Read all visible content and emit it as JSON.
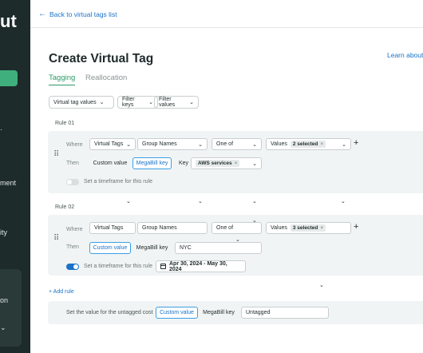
{
  "sidebar": {
    "logo": "ut",
    "items": [
      {
        "label": "ment"
      },
      {
        "label": "ity"
      },
      {
        "label": "on"
      }
    ]
  },
  "topbar": {
    "back_label": "Back to virtual tags list",
    "back_icon": "arrow-left-icon"
  },
  "page": {
    "title": "Create Virtual Tag",
    "learn_link": "Learn about",
    "tabs": [
      {
        "label": "Tagging",
        "active": true
      },
      {
        "label": "Reallocation",
        "active": false
      }
    ]
  },
  "filters": [
    {
      "label": "Virtual tag values"
    },
    {
      "label": "Filter keys"
    },
    {
      "label": "Filter values"
    }
  ],
  "rules": [
    {
      "label": "Rule 01",
      "where_label": "Where",
      "then_label": "Then",
      "conditions": {
        "key_type": "Virtual Tags",
        "key": "Group Names",
        "operator": "One of",
        "values_label": "Values",
        "values_chip": "2 selected"
      },
      "then": {
        "custom_value": "Custom value",
        "megabill_key": "MegaBill key",
        "selected_mode": "megabill_key",
        "key_label": "Key",
        "key_chip": "AWS services"
      },
      "timeframe": {
        "enabled": false,
        "label": "Set a timeframe for this rule"
      }
    },
    {
      "label": "Rule 02",
      "where_label": "Where",
      "then_label": "Then",
      "conditions": {
        "key_type": "Virtual Tags",
        "key": "Group Names",
        "operator": "One of",
        "values_label": "Values",
        "values_chip": "3 selected"
      },
      "then": {
        "custom_value": "Custom value",
        "megabill_key": "MegaBill key",
        "selected_mode": "custom_value",
        "value": "NYC"
      },
      "timeframe": {
        "enabled": true,
        "label": "Set a timeframe for this rule",
        "range": "Apr 30, 2024 - May 30, 2024"
      }
    }
  ],
  "add_rule": "+ Add rule",
  "untagged": {
    "label": "Set the value for the untagged cost",
    "custom_value": "Custom value",
    "megabill_key": "MegaBill key",
    "value": "Untagged"
  },
  "colors": {
    "accent_green": "#2f9a67",
    "link_blue": "#1a73c8",
    "sidebar_bg": "#1d2b2a"
  }
}
